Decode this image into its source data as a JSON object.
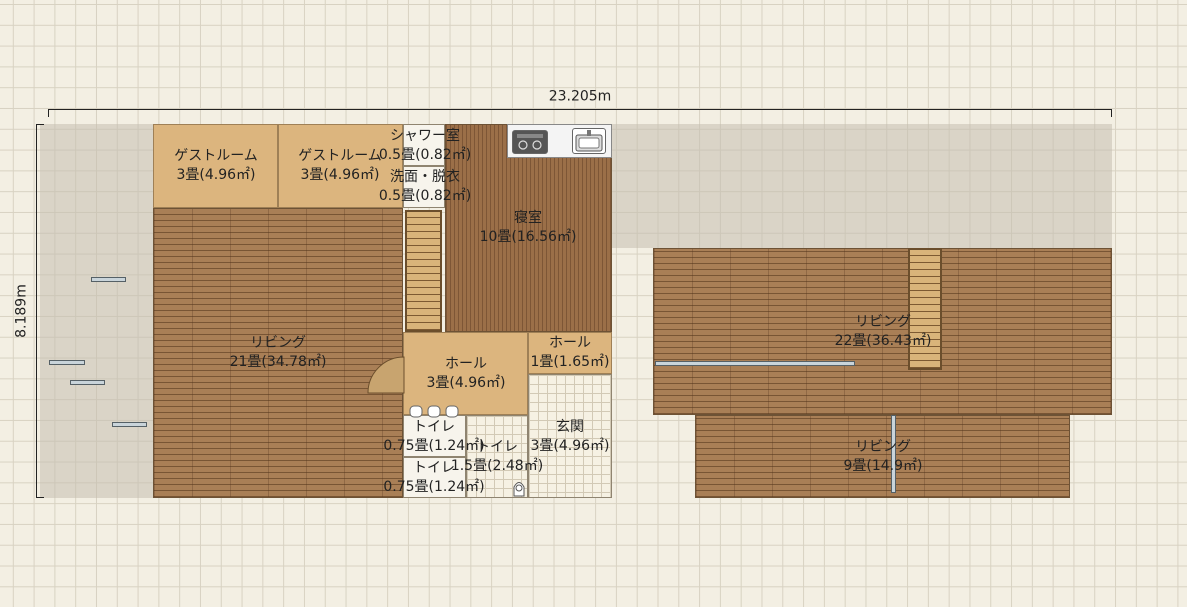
{
  "dimensions": {
    "width_label": "23.205m",
    "height_label": "8.189m"
  },
  "rooms": [
    {
      "name": "ゲストルーム",
      "area": "3畳(4.96㎡)"
    },
    {
      "name": "ゲストルーム",
      "area": "3畳(4.96㎡)"
    },
    {
      "name": "シャワー室",
      "area": "0.5畳(0.82㎡)"
    },
    {
      "name": "洗面・脱衣",
      "area": "0.5畳(0.82㎡)"
    },
    {
      "name": "寝室",
      "area": "10畳(16.56㎡)"
    },
    {
      "name": "リビング",
      "area": "21畳(34.78㎡)"
    },
    {
      "name": "ホール",
      "area": "3畳(4.96㎡)"
    },
    {
      "name": "ホール",
      "area": "1畳(1.65㎡)"
    },
    {
      "name": "玄関",
      "area": "3畳(4.96㎡)"
    },
    {
      "name": "トイレ",
      "area": "0.75畳(1.24㎡)"
    },
    {
      "name": "トイレ",
      "area": "0.75畳(1.24㎡)"
    },
    {
      "name": "トイレ",
      "area": "1.5畳(2.48㎡)"
    },
    {
      "name": "リビング",
      "area": "22畳(36.43㎡)"
    },
    {
      "name": "リビング",
      "area": "9畳(14.9㎡)"
    }
  ],
  "colors": {
    "wood": "#a97f56",
    "tatami": "#dcb57e",
    "grid_background": "#f3efe3"
  },
  "icons": [
    "cooktop-icon",
    "sink-icon",
    "toilet-icon",
    "door-swing-icon"
  ]
}
